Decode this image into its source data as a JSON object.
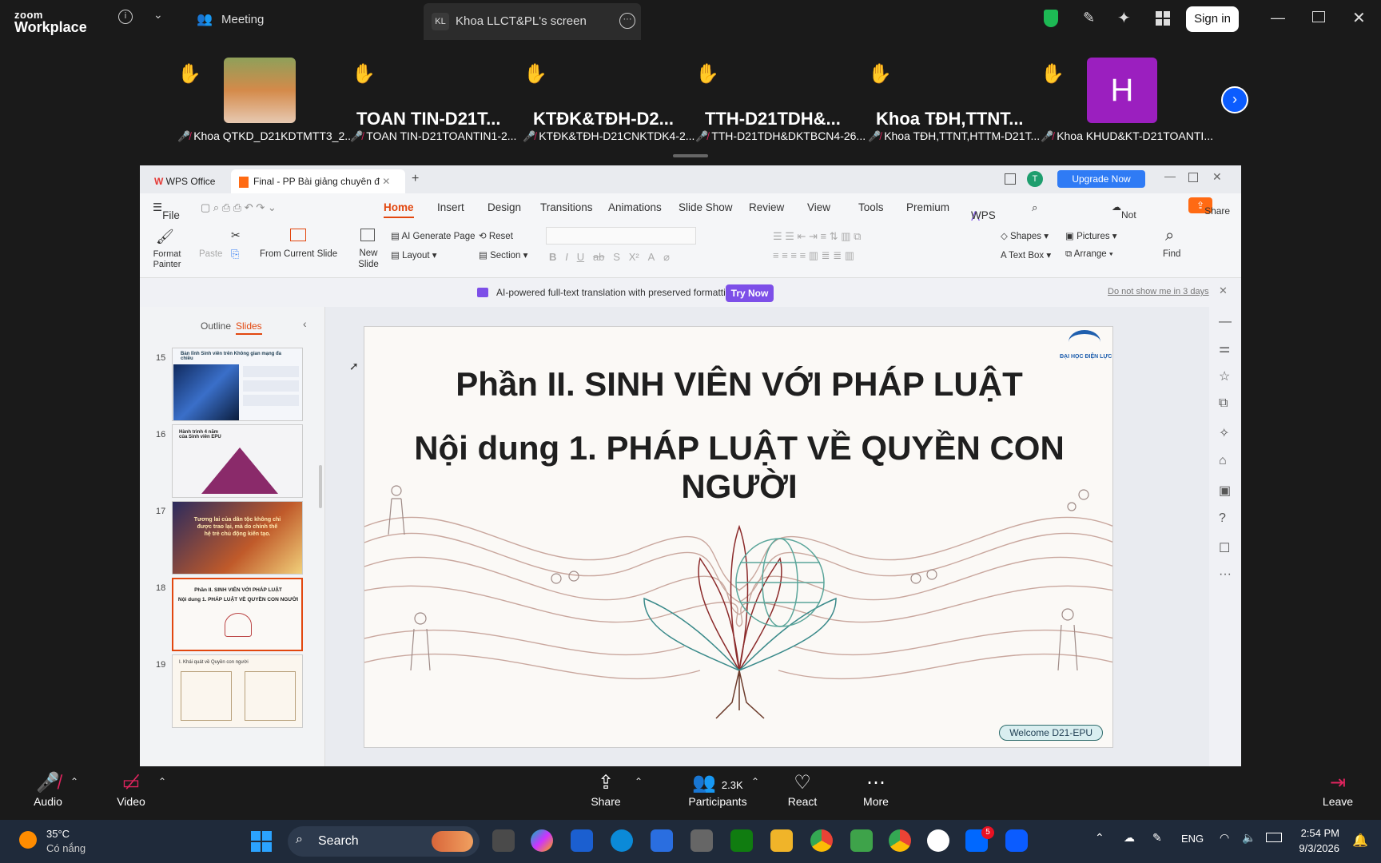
{
  "zoom": {
    "logo_line1": "zoom",
    "logo_line2": "Workplace",
    "meeting_label": "Meeting",
    "screen_tab": "Khoa LLCT&PL's screen",
    "screen_tab_initials": "KL",
    "sign_in": "Sign in"
  },
  "participants": [
    {
      "big": "",
      "name": "Khoa QTKD_D21KDTMTT3_2..."
    },
    {
      "big": "TOAN TIN-D21T...",
      "name": "TOAN TIN-D21TOANTIN1-2..."
    },
    {
      "big": "KTĐK&TĐH-D2...",
      "name": "KTĐK&TĐH-D21CNKTDK4-2..."
    },
    {
      "big": "TTH-D21TDH&...",
      "name": "TTH-D21TDH&DKTBCN4-26..."
    },
    {
      "big": "Khoa  TĐH,TTNT...",
      "name": "Khoa TĐH,TTNT,HTTM-D21T..."
    },
    {
      "big": "H",
      "name": "Khoa KHUD&KT-D21TOANTI..."
    }
  ],
  "wps": {
    "app_tab": "WPS Office",
    "doc_tab": "Final - PP Bài giảng chuyên đ",
    "upgrade": "Upgrade Now",
    "user_initial": "T",
    "menu": [
      "File",
      "Home",
      "Insert",
      "Design",
      "Transitions",
      "Animations",
      "Slide Show",
      "Review",
      "View",
      "Tools",
      "Premium",
      "WPS AI"
    ],
    "not_uploaded": "Not uploaded",
    "share": "Share",
    "ribbon": {
      "format_painter": "Format Painter",
      "paste": "Paste",
      "from_current_slide": "From Current Slide",
      "new_slide": "New Slide",
      "ai_generate": "AI Generate Page",
      "layout": "Layout",
      "reset": "Reset",
      "section": "Section",
      "shapes": "Shapes",
      "pictures": "Pictures",
      "text_box": "Text Box",
      "arrange": "Arrange",
      "find": "Find"
    },
    "translation_msg": "AI-powered full-text translation with preserved formatting.",
    "try_now": "Try Now",
    "dont_show": "Do not show me in 3 days",
    "panel_tabs": [
      "Outline",
      "Slides"
    ],
    "thumbs": [
      {
        "num": "15",
        "title": "Bản lĩnh Sinh viên trên Không gian mạng đa chiều"
      },
      {
        "num": "16",
        "title": "Hành trình 4 năm của Sinh viên EPU"
      },
      {
        "num": "17",
        "title": "Tương lai của dân tộc không chỉ được trao lại, mà do chính thế hệ trẻ chủ động kiến tạo."
      },
      {
        "num": "18",
        "title": "Phần II. SINH VIÊN VỚI PHÁP LUẬT\nNội dung 1. PHÁP LUẬT VỀ QUYỀN CON NGƯỜI"
      },
      {
        "num": "19",
        "title": "I. Khái quát về Quyền con người"
      }
    ],
    "slide": {
      "title1": "Phần II. SINH VIÊN VỚI PHÁP LUẬT",
      "title2": "Nội dung 1. PHÁP LUẬT VỀ QUYỀN CON NGƯỜI",
      "logo_text": "ĐẠI HỌC ĐIỆN LỰC",
      "welcome": "Welcome D21-EPU"
    }
  },
  "toolbar": {
    "audio": "Audio",
    "video": "Video",
    "share": "Share",
    "participants": "Participants",
    "participants_count": "2.3K",
    "react": "React",
    "more": "More",
    "leave": "Leave"
  },
  "taskbar": {
    "temp": "35°C",
    "weather": "Có nắng",
    "search": "Search",
    "lang": "ENG",
    "time": "2:54 PM",
    "date": "9/3/2026",
    "badge": "5"
  },
  "colors": {
    "accent_purple": "#7d4fe8",
    "wps_orange": "#ff6a13",
    "zoom_blue": "#0b5cff",
    "mic_red": "#e0245e"
  }
}
